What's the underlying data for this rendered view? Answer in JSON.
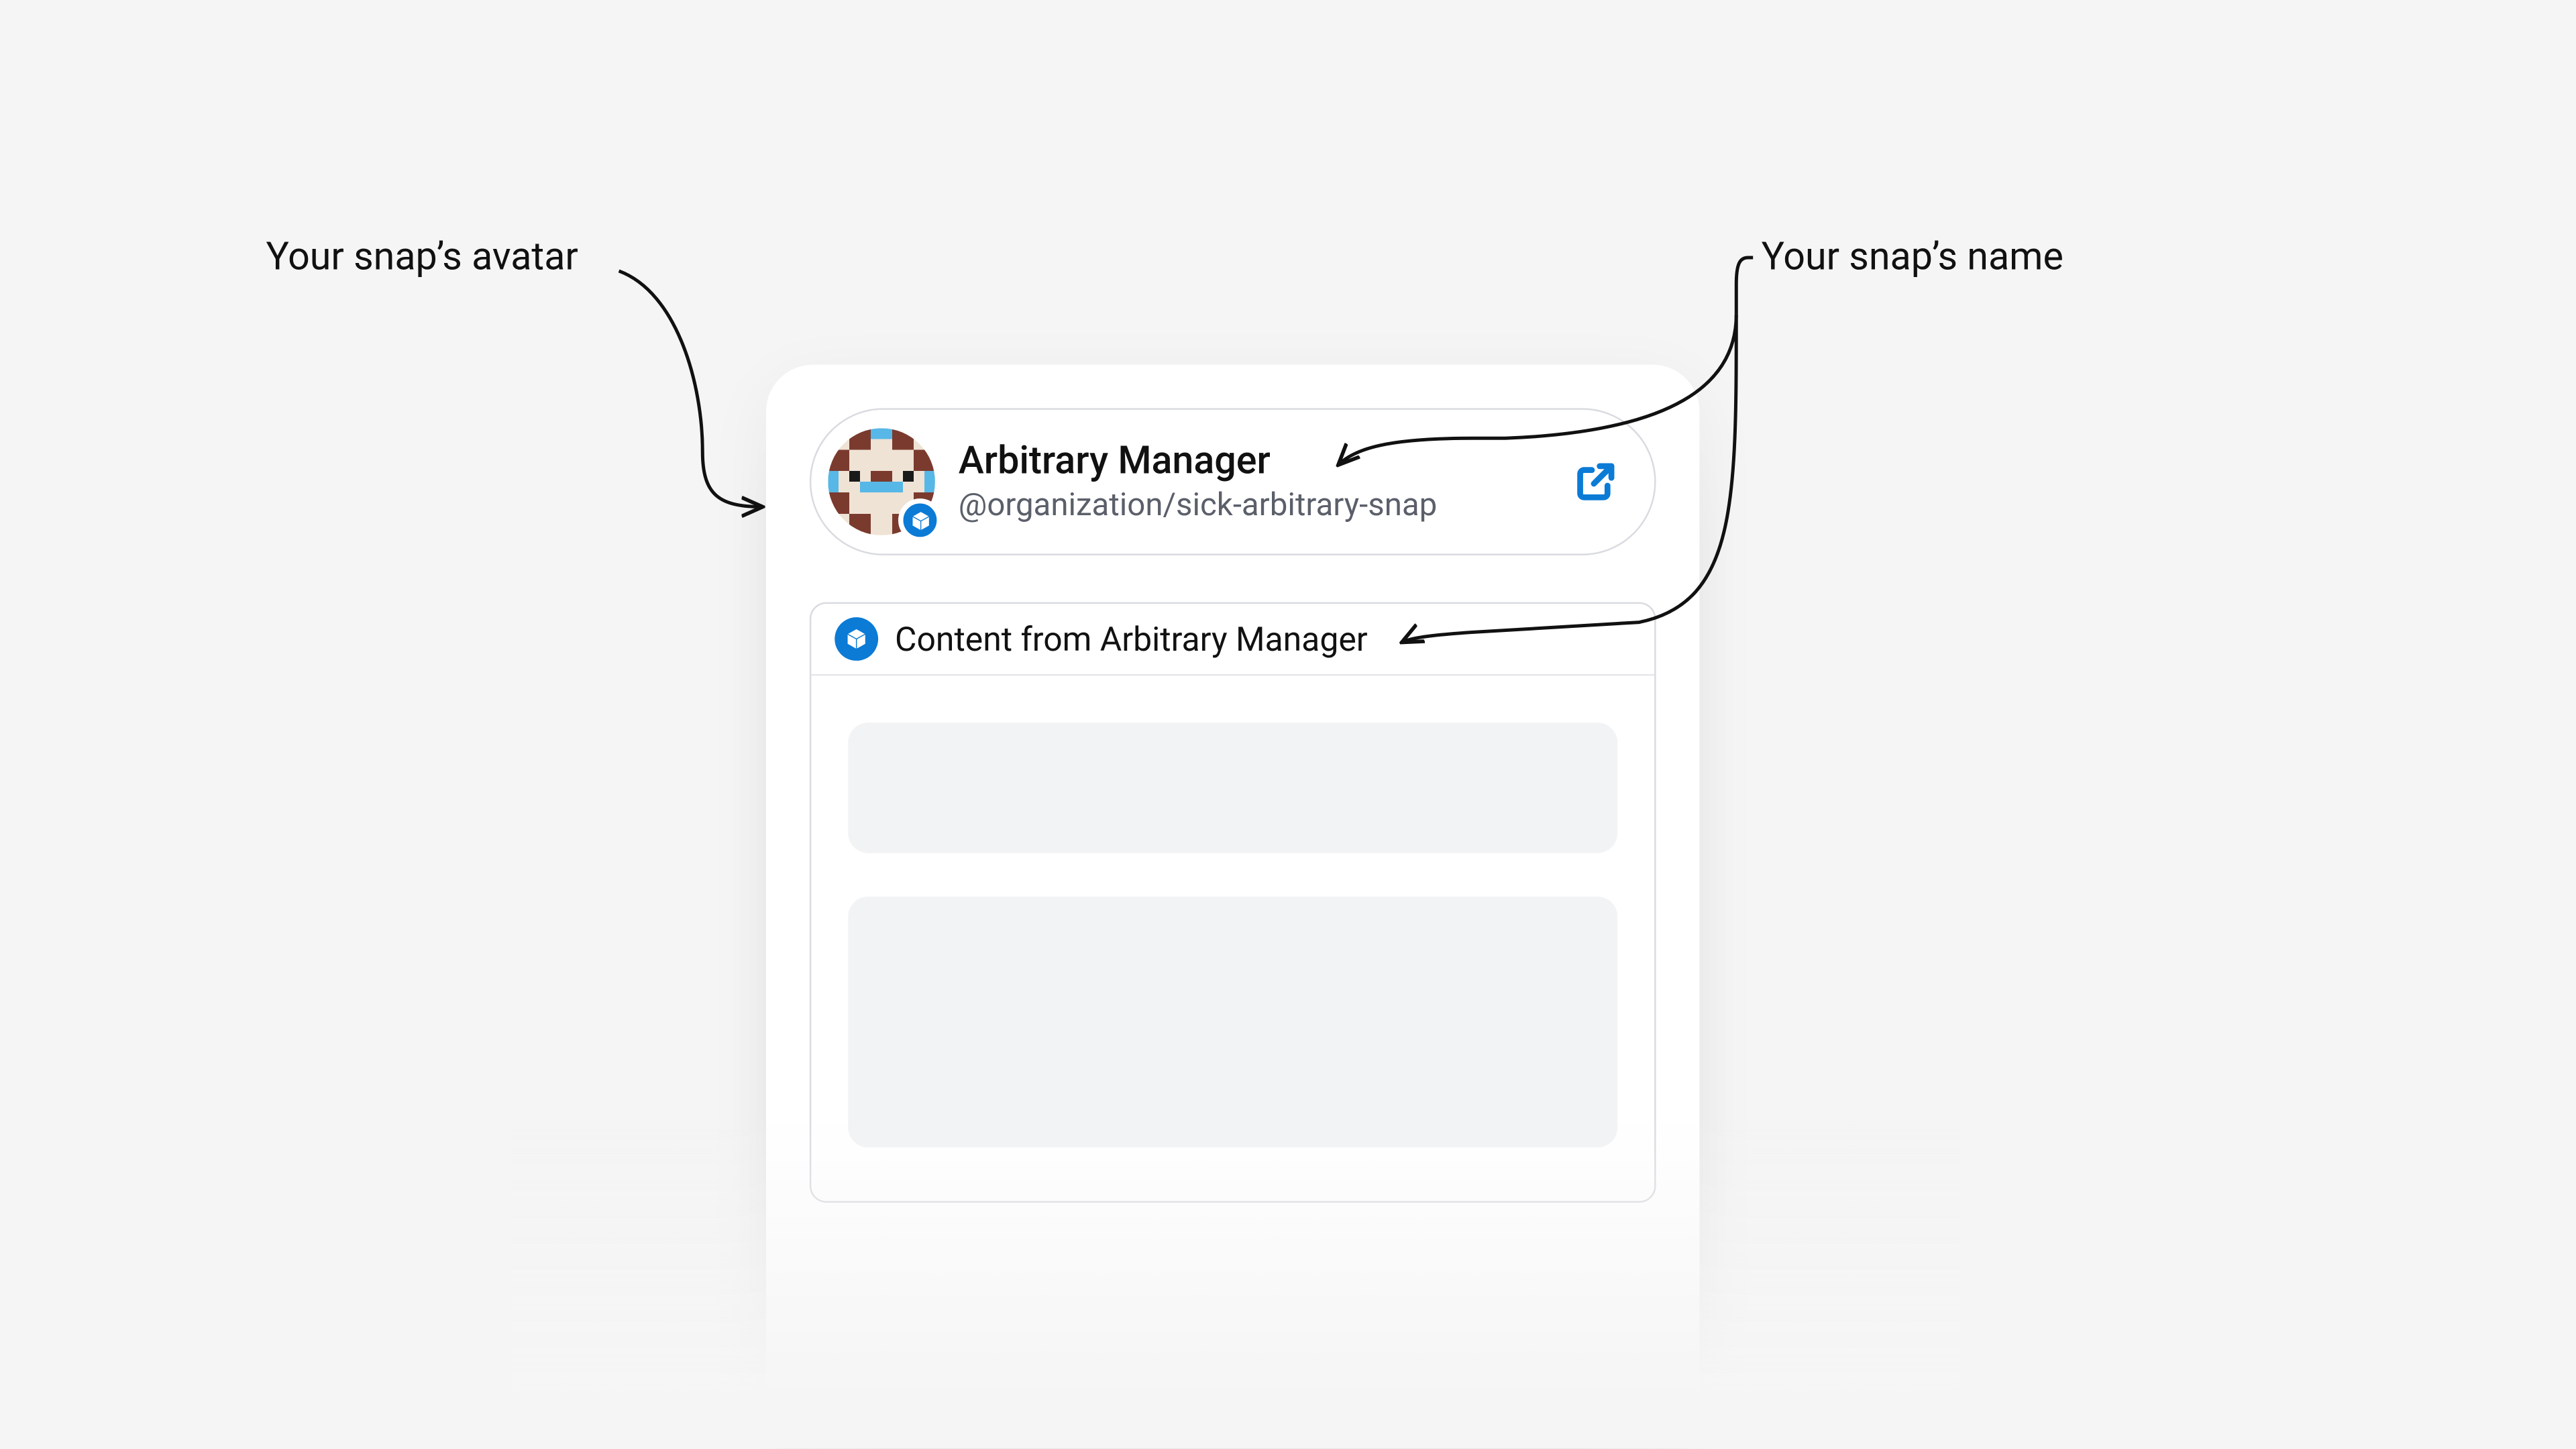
{
  "annotations": {
    "avatar": "Your snap’s avatar",
    "name": "Your snap’s name"
  },
  "header": {
    "snap_name": "Arbitrary Manager",
    "snap_handle": "@organization/sick-arbitrary-snap"
  },
  "content": {
    "title": "Content from Arbitrary Manager"
  },
  "colors": {
    "accent": "#0b7bd6",
    "page_bg": "#f5f5f5",
    "card_bg": "#ffffff",
    "border": "#d9dbe0",
    "placeholder": "#f2f3f5"
  }
}
